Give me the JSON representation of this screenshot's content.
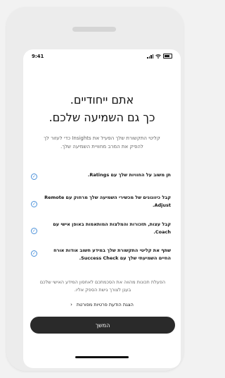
{
  "status_bar": {
    "time": "9:41"
  },
  "heading": {
    "line1": "אתם ייחודיים.",
    "line2": "כך גם השמיעה שלכם."
  },
  "intro_text": "קליטי התקשורת שלך הפעיל את Insights כדי לעזור לך להפיק את המרב מחוויית השמיעה שלך.",
  "features": [
    {
      "text": "תן משוב על החוויות שלך עם Ratings."
    },
    {
      "text": "קבל כיוונונים של מכשירי השמיעה שלך מרחוק עם Remote Adjust."
    },
    {
      "text": "קבל עצות, תזכורות והמלצות המותאמות באופן אישי עם Coach."
    },
    {
      "text": "שתף את קליטי התקשורת שלך במידע חשוב אודות אורח החיים השמיעתי שלך עם Success Check."
    }
  ],
  "note_text": "הפעלת תכונות מהווה את הסכמתכם לאחסון המידע האישי שלכם בענן לצורך גישת הספק אליו.",
  "privacy_link": "הצגת הודעת פרטיות מפורטת",
  "continue_button": "המשך",
  "icons": {
    "check": "check-circle-icon",
    "chevron": "chevron-left-icon",
    "signal": "signal-icon",
    "wifi": "wifi-icon",
    "battery": "battery-icon"
  },
  "colors": {
    "accent": "#4a90d9",
    "button": "#2a2a2a"
  }
}
